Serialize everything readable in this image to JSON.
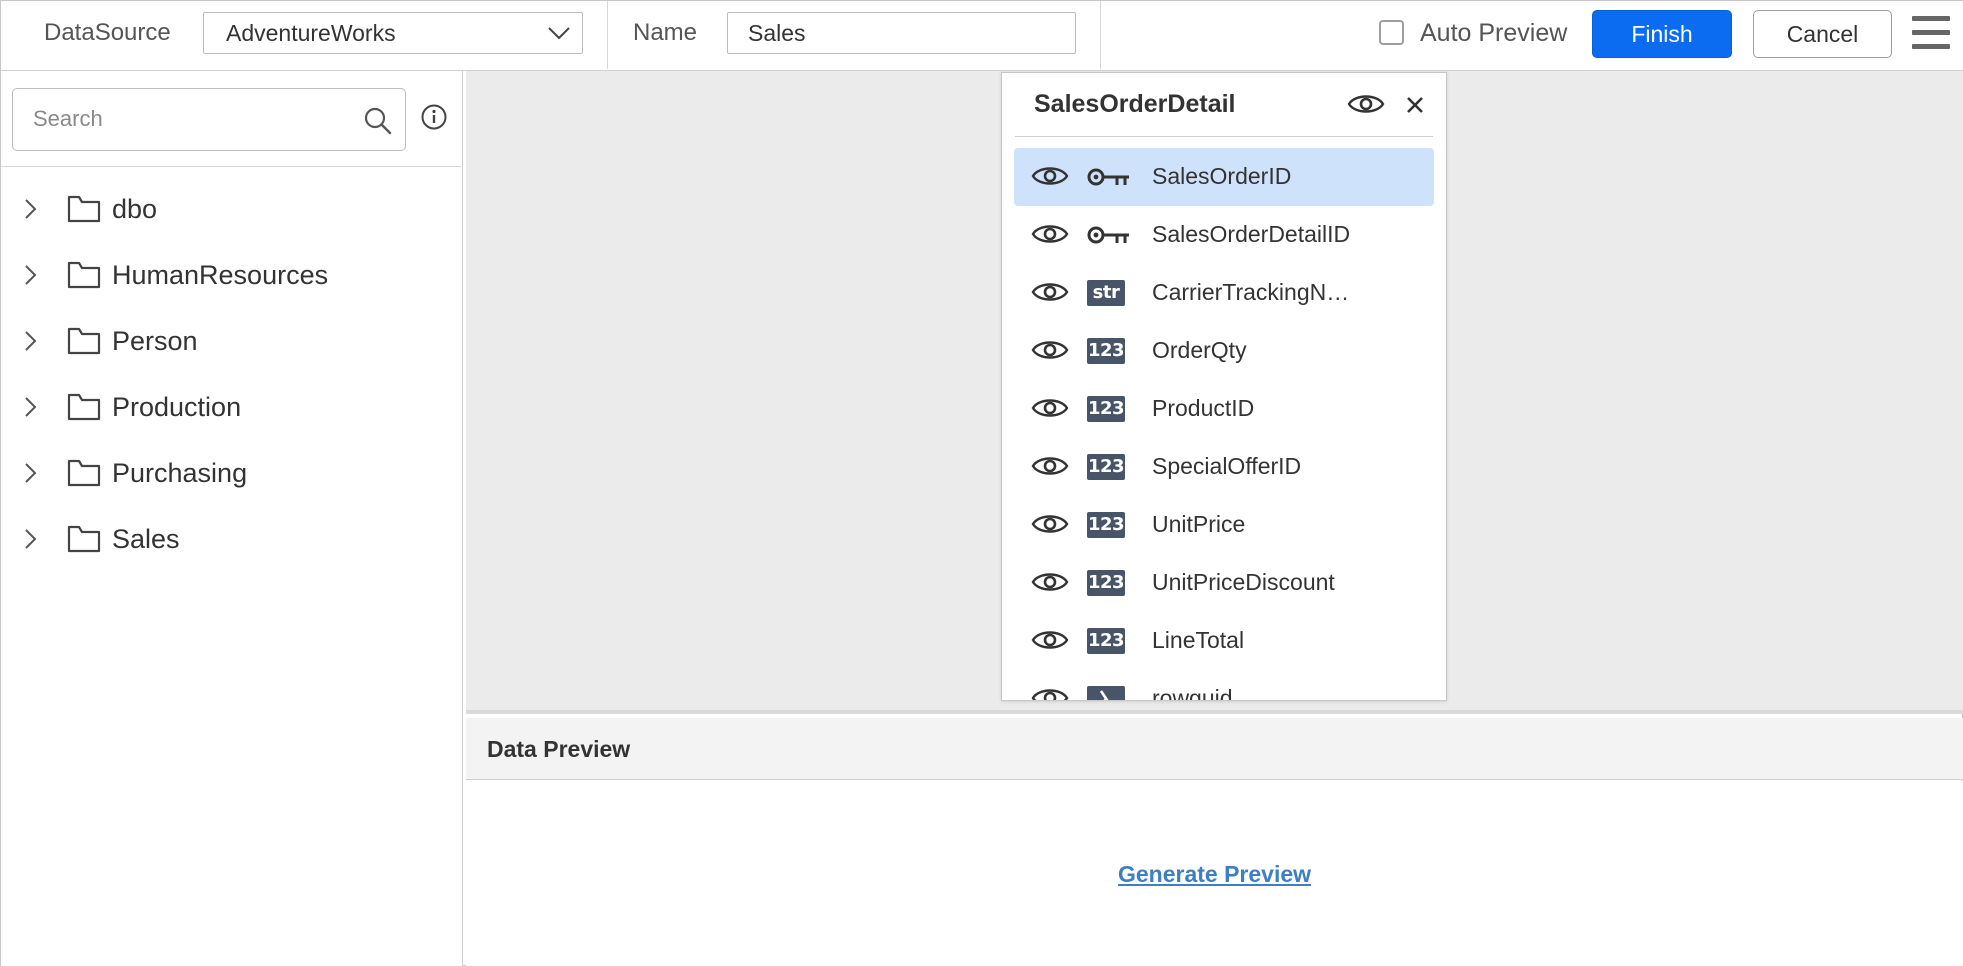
{
  "toolbar": {
    "datasource_label": "DataSource",
    "datasource_value": "AdventureWorks",
    "name_label": "Name",
    "name_value": "Sales",
    "auto_preview_label": "Auto Preview",
    "auto_preview_checked": false,
    "finish_label": "Finish",
    "cancel_label": "Cancel"
  },
  "sidebar": {
    "search_placeholder": "Search",
    "items": [
      {
        "label": "dbo"
      },
      {
        "label": "HumanResources"
      },
      {
        "label": "Person"
      },
      {
        "label": "Production"
      },
      {
        "label": "Purchasing"
      },
      {
        "label": "Sales"
      }
    ]
  },
  "table_card": {
    "title": "SalesOrderDetail",
    "columns": [
      {
        "name": "SalesOrderID",
        "type": "key-icon",
        "selected": true
      },
      {
        "name": "SalesOrderDetailID",
        "type": "key-icon",
        "selected": false
      },
      {
        "name": "CarrierTrackingNumber",
        "type": "str",
        "selected": false
      },
      {
        "name": "OrderQty",
        "type": "123",
        "selected": false
      },
      {
        "name": "ProductID",
        "type": "123",
        "selected": false
      },
      {
        "name": "SpecialOfferID",
        "type": "123",
        "selected": false
      },
      {
        "name": "UnitPrice",
        "type": "123",
        "selected": false
      },
      {
        "name": "UnitPriceDiscount",
        "type": "123",
        "selected": false
      },
      {
        "name": "LineTotal",
        "type": "123",
        "selected": false
      },
      {
        "name": "rowguid",
        "type": "guid-icon",
        "selected": false
      }
    ]
  },
  "preview": {
    "header": "Data Preview",
    "generate_label": "Generate Preview"
  },
  "colors": {
    "primary": "#0b6cf2",
    "selected_row": "#cfe2fb",
    "type_badge": "#485568",
    "link": "#3c7fc4",
    "canvas_bg": "#ebebeb"
  }
}
